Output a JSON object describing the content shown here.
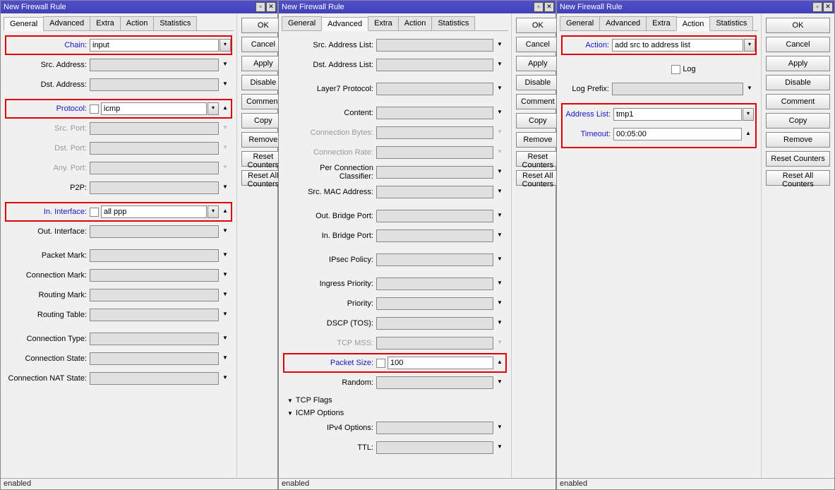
{
  "windows": [
    {
      "title": "New Firewall Rule",
      "status": "enabled",
      "tabs": [
        "General",
        "Advanced",
        "Extra",
        "Action",
        "Statistics"
      ],
      "active_tab": "General",
      "buttons": [
        "OK",
        "Cancel",
        "Apply",
        "Disable",
        "Comment",
        "Copy",
        "Remove",
        "Reset Counters",
        "Reset All Counters"
      ],
      "fields": {
        "chain": {
          "label": "Chain:",
          "value": "input",
          "blue": true,
          "hl": true
        },
        "src_address": {
          "label": "Src. Address:",
          "value": ""
        },
        "dst_address": {
          "label": "Dst. Address:",
          "value": ""
        },
        "protocol": {
          "label": "Protocol:",
          "value": "icmp",
          "blue": true,
          "hl": true,
          "chk": true
        },
        "src_port": {
          "label": "Src. Port:",
          "value": "",
          "grey": true
        },
        "dst_port": {
          "label": "Dst. Port:",
          "value": "",
          "grey": true
        },
        "any_port": {
          "label": "Any. Port:",
          "value": "",
          "grey": true
        },
        "p2p": {
          "label": "P2P:",
          "value": ""
        },
        "in_interface": {
          "label": "In. Interface:",
          "value": "all ppp",
          "blue": true,
          "hl": true,
          "chk": true
        },
        "out_interface": {
          "label": "Out. Interface:",
          "value": ""
        },
        "packet_mark": {
          "label": "Packet Mark:",
          "value": ""
        },
        "connection_mark": {
          "label": "Connection Mark:",
          "value": ""
        },
        "routing_mark": {
          "label": "Routing Mark:",
          "value": ""
        },
        "routing_table": {
          "label": "Routing Table:",
          "value": ""
        },
        "connection_type": {
          "label": "Connection Type:",
          "value": ""
        },
        "connection_state": {
          "label": "Connection State:",
          "value": ""
        },
        "connection_nat_state": {
          "label": "Connection NAT State:",
          "value": ""
        }
      }
    },
    {
      "title": "New Firewall Rule",
      "status": "enabled",
      "tabs": [
        "General",
        "Advanced",
        "Extra",
        "Action",
        "Statistics"
      ],
      "active_tab": "Advanced",
      "buttons": [
        "OK",
        "Cancel",
        "Apply",
        "Disable",
        "Comment",
        "Copy",
        "Remove",
        "Reset Counters",
        "Reset All Counters"
      ],
      "fields": {
        "src_addr_list": {
          "label": "Src. Address List:",
          "value": ""
        },
        "dst_addr_list": {
          "label": "Dst. Address List:",
          "value": ""
        },
        "layer7": {
          "label": "Layer7 Protocol:",
          "value": ""
        },
        "content": {
          "label": "Content:",
          "value": ""
        },
        "conn_bytes": {
          "label": "Connection Bytes:",
          "value": "",
          "grey": true
        },
        "conn_rate": {
          "label": "Connection Rate:",
          "value": "",
          "grey": true
        },
        "pcc": {
          "label": "Per Connection Classifier:",
          "value": ""
        },
        "src_mac": {
          "label": "Src. MAC Address:",
          "value": ""
        },
        "out_bridge": {
          "label": "Out. Bridge Port:",
          "value": ""
        },
        "in_bridge": {
          "label": "In. Bridge Port:",
          "value": ""
        },
        "ipsec": {
          "label": "IPsec Policy:",
          "value": ""
        },
        "ingress_prio": {
          "label": "Ingress Priority:",
          "value": ""
        },
        "priority": {
          "label": "Priority:",
          "value": ""
        },
        "dscp": {
          "label": "DSCP (TOS):",
          "value": ""
        },
        "tcp_mss": {
          "label": "TCP MSS:",
          "value": "",
          "grey": true
        },
        "packet_size": {
          "label": "Packet Size:",
          "value": "100",
          "blue": true,
          "hl": true,
          "chk": true
        },
        "random": {
          "label": "Random:",
          "value": ""
        },
        "tcp_flags": {
          "label": "TCP Flags"
        },
        "icmp_options": {
          "label": "ICMP Options"
        },
        "ipv4_options": {
          "label": "IPv4 Options:",
          "value": ""
        },
        "ttl": {
          "label": "TTL:",
          "value": ""
        }
      }
    },
    {
      "title": "New Firewall Rule",
      "status": "enabled",
      "tabs": [
        "General",
        "Advanced",
        "Extra",
        "Action",
        "Statistics"
      ],
      "active_tab": "Action",
      "buttons": [
        "OK",
        "Cancel",
        "Apply",
        "Disable",
        "Comment",
        "Copy",
        "Remove",
        "Reset Counters",
        "Reset All Counters"
      ],
      "fields": {
        "action": {
          "label": "Action:",
          "value": "add src to address list",
          "blue": true,
          "hl": true
        },
        "log": {
          "label": "Log",
          "checked": false
        },
        "log_prefix": {
          "label": "Log Prefix:",
          "value": ""
        },
        "address_list": {
          "label": "Address List:",
          "value": "tmp1",
          "blue": true,
          "hl": true
        },
        "timeout": {
          "label": "Timeout:",
          "value": "00:05:00",
          "blue": true,
          "hl": true
        }
      }
    }
  ]
}
